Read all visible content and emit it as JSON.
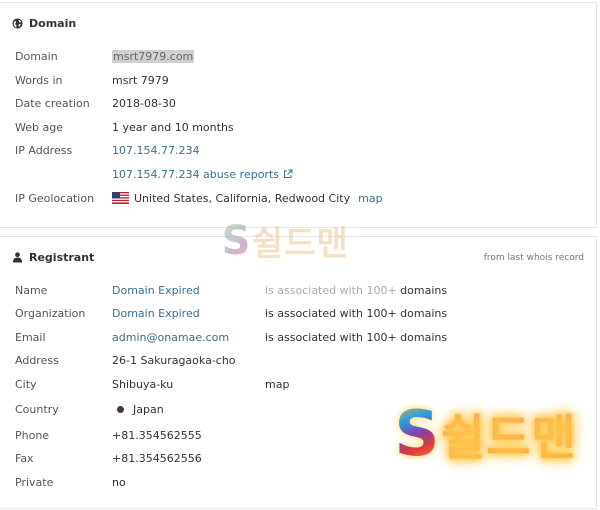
{
  "domain_panel": {
    "title": "Domain",
    "icon": "globe-icon",
    "rows": {
      "domain": {
        "label": "Domain",
        "value": "msrt7979.com"
      },
      "words_in": {
        "label": "Words in",
        "value": "msrt 7979"
      },
      "date_creation": {
        "label": "Date creation",
        "value": "2018-08-30"
      },
      "web_age": {
        "label": "Web age",
        "value": "1 year and 10 months"
      },
      "ip_address": {
        "label": "IP Address",
        "value": "107.154.77.234",
        "abuse_link": "107.154.77.234 abuse reports"
      },
      "ip_geolocation": {
        "label": "IP Geolocation",
        "flag": "us-flag-icon",
        "value": "United States, California, Redwood City",
        "map_link": "map"
      }
    }
  },
  "registrant_panel": {
    "title": "Registrant",
    "icon": "user-icon",
    "note": "from last whois record",
    "rows": {
      "name": {
        "label": "Name",
        "value": "Domain Expired",
        "assoc_prefix": "is associated with 100+",
        "assoc_suffix": "domains"
      },
      "organization": {
        "label": "Organization",
        "value": "Domain Expired",
        "assoc": "is associated with 100+ domains"
      },
      "email": {
        "label": "Email",
        "value": "admin@onamae.com",
        "assoc": "is associated with 100+ domains"
      },
      "address": {
        "label": "Address",
        "value": "26-1 Sakuragaoka-cho"
      },
      "city": {
        "label": "City",
        "value": "Shibuya-ku",
        "map_link": "map"
      },
      "country": {
        "label": "Country",
        "flag": "jp-flag-icon",
        "value": "Japan"
      },
      "phone": {
        "label": "Phone",
        "value": "+81.354562555"
      },
      "fax": {
        "label": "Fax",
        "value": "+81.354562556"
      },
      "private": {
        "label": "Private",
        "value": "no"
      }
    }
  },
  "watermark": {
    "letter": "S",
    "text": "쉴드맨"
  },
  "colors": {
    "link": "#3a6e94",
    "label": "#555555",
    "border": "#e6e6e6"
  }
}
